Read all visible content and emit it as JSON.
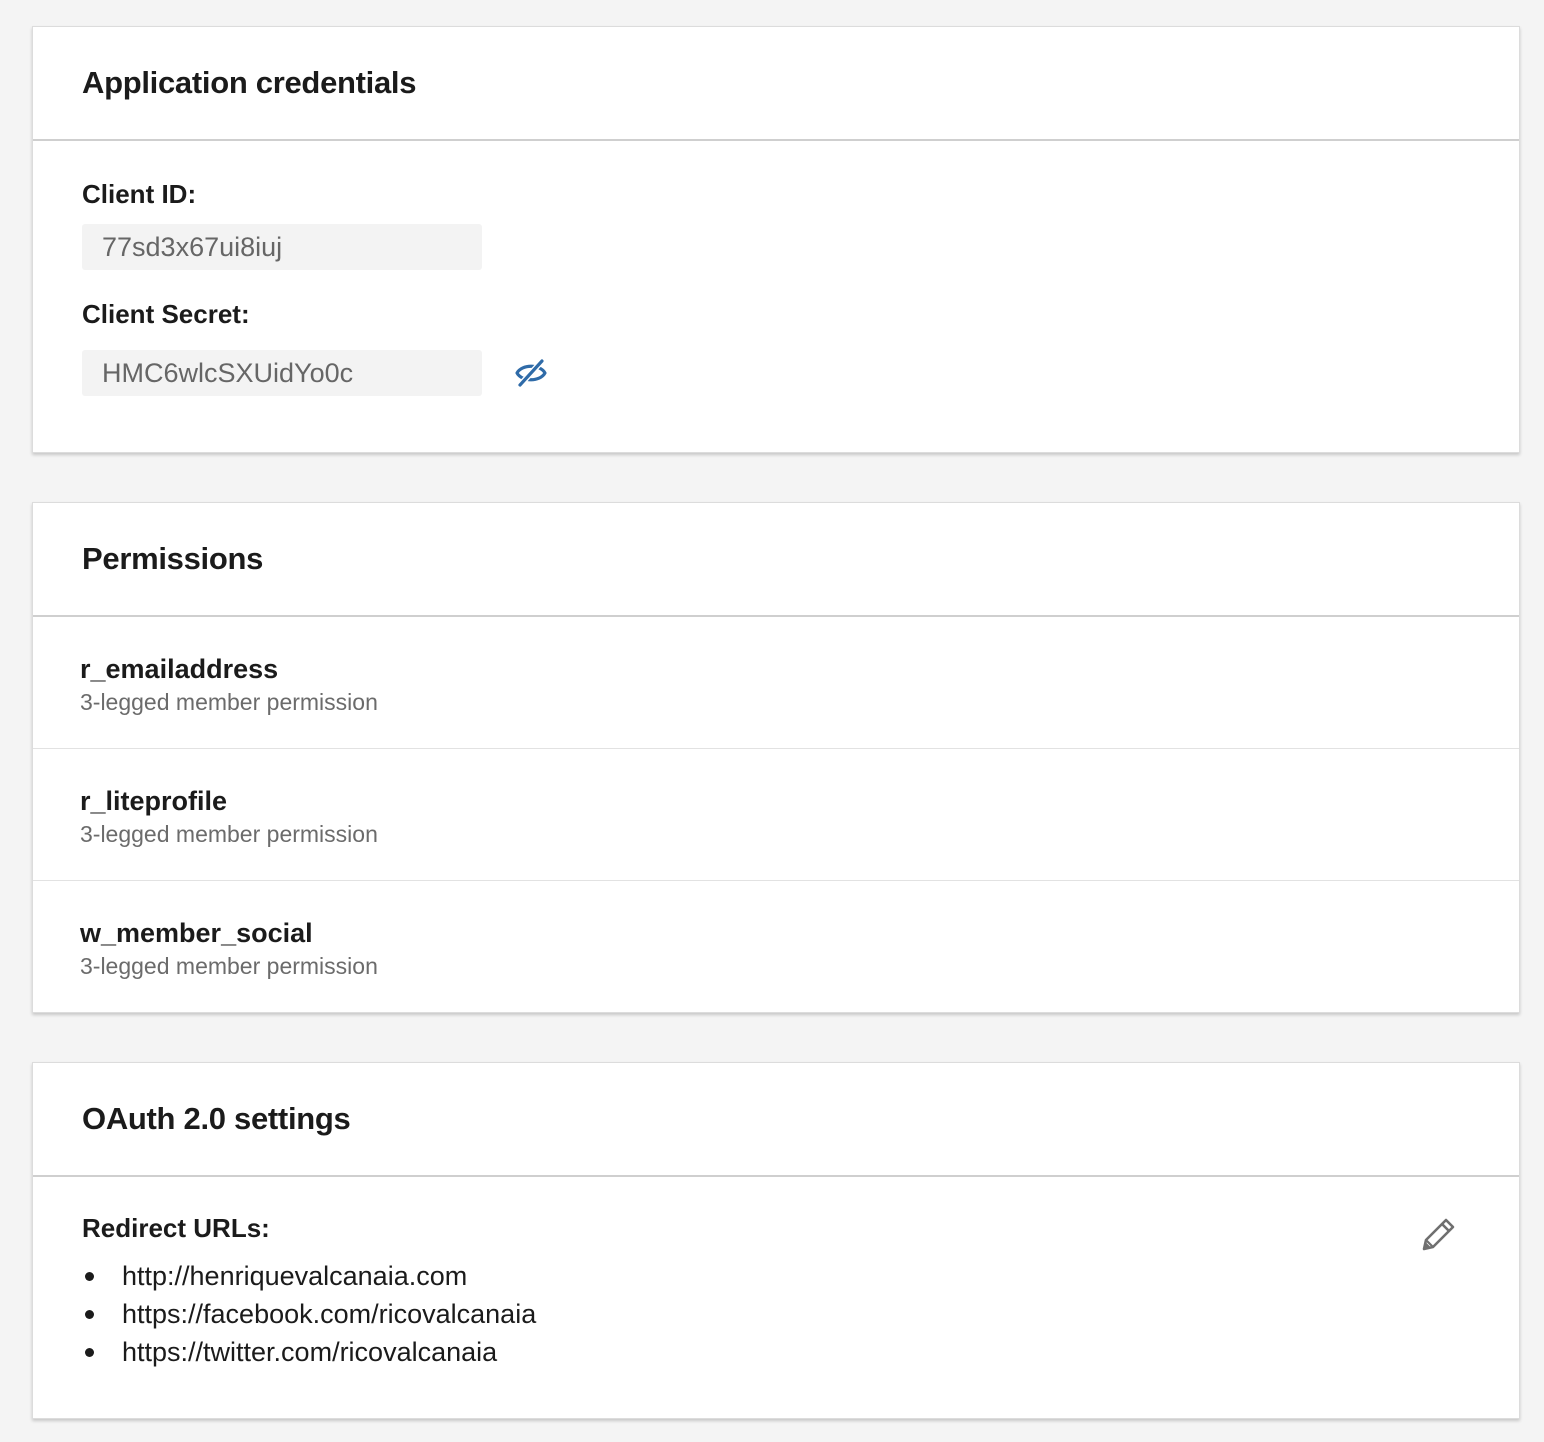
{
  "credentials": {
    "title": "Application credentials",
    "client_id_label": "Client ID:",
    "client_id_value": "77sd3x67ui8iuj",
    "client_secret_label": "Client Secret:",
    "client_secret_value": "HMC6wlcSXUidYo0c",
    "visibility_icon": "eye-slash-icon",
    "accent_color": "#2f6ba8"
  },
  "permissions": {
    "title": "Permissions",
    "items": [
      {
        "name": "r_emailaddress",
        "description": "3-legged member permission"
      },
      {
        "name": "r_liteprofile",
        "description": "3-legged member permission"
      },
      {
        "name": "w_member_social",
        "description": "3-legged member permission"
      }
    ]
  },
  "oauth": {
    "title": "OAuth 2.0 settings",
    "redirect_label": "Redirect URLs:",
    "urls": [
      "http://henriquevalcanaia.com",
      "https://facebook.com/ricovalcanaia",
      "https://twitter.com/ricovalcanaia"
    ],
    "edit_icon": "pencil-icon"
  }
}
